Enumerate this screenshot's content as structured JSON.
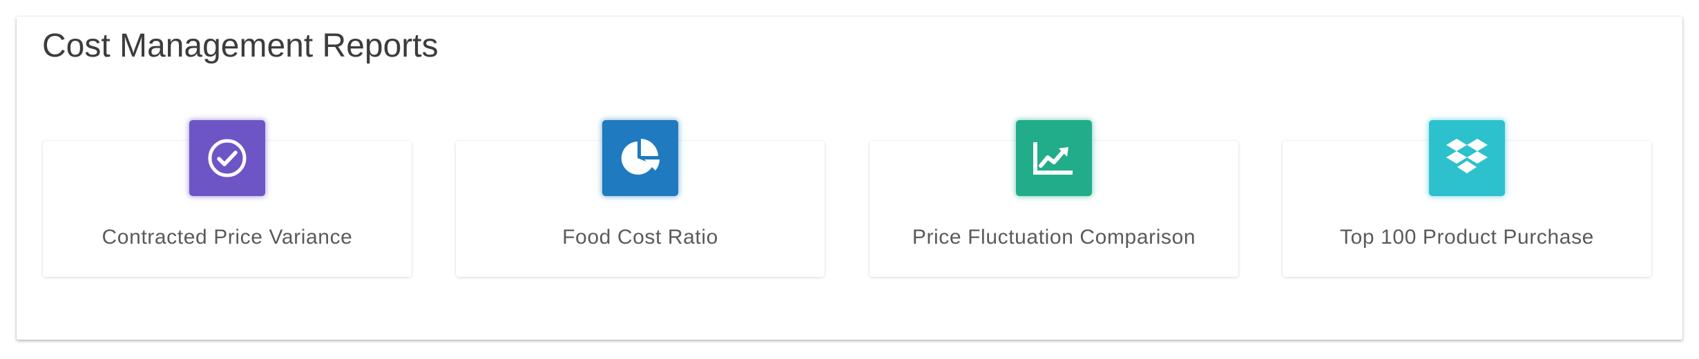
{
  "panel": {
    "title": "Cost Management Reports"
  },
  "cards": [
    {
      "label": "Contracted Price Variance",
      "icon": "check-circle-icon",
      "color": "#6d55c6",
      "glow": "rgba(109,85,198,0.55)"
    },
    {
      "label": "Food Cost Ratio",
      "icon": "pie-chart-icon",
      "color": "#1f7abf",
      "glow": "rgba(31,122,191,0.55)"
    },
    {
      "label": "Price Fluctuation Comparison",
      "icon": "area-chart-icon",
      "color": "#21ad89",
      "glow": "rgba(33,173,137,0.55)"
    },
    {
      "label": "Top 100 Product Purchase",
      "icon": "dropbox-icon",
      "color": "#2cc1cd",
      "glow": "rgba(44,193,205,0.55)"
    }
  ]
}
